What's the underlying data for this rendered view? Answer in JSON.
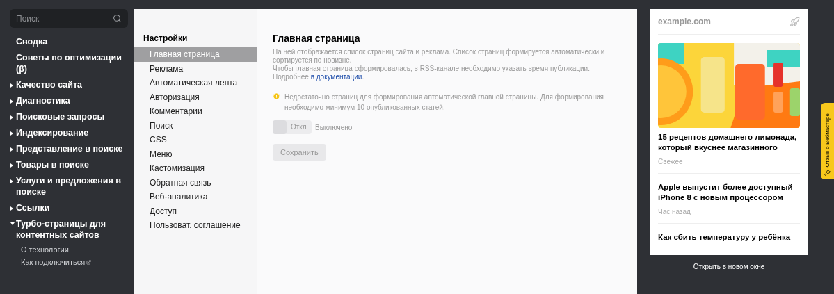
{
  "search": {
    "placeholder": "Поиск"
  },
  "sidebar": {
    "items": [
      {
        "label": "Сводка",
        "kind": "link"
      },
      {
        "label": "Советы по оптимизации (β)",
        "kind": "link"
      },
      {
        "label": "Качество сайта",
        "kind": "group",
        "expanded": false
      },
      {
        "label": "Диагностика",
        "kind": "group",
        "expanded": false
      },
      {
        "label": "Поисковые запросы",
        "kind": "group",
        "expanded": false
      },
      {
        "label": "Индексирование",
        "kind": "group",
        "expanded": false
      },
      {
        "label": "Представление в поиске",
        "kind": "group",
        "expanded": false
      },
      {
        "label": "Товары в поиске",
        "kind": "group",
        "expanded": false
      },
      {
        "label": "Услуги и предложения в поиске",
        "kind": "group",
        "expanded": false
      },
      {
        "label": "Ссылки",
        "kind": "group",
        "expanded": false
      },
      {
        "label": "Турбо-страницы для контентных сайтов",
        "kind": "group",
        "expanded": true,
        "children": [
          {
            "label": "О технологии",
            "external": false
          },
          {
            "label": "Как подключиться",
            "external": true
          }
        ]
      }
    ]
  },
  "settings_nav": {
    "title": "Настройки",
    "items": [
      {
        "label": "Главная страница",
        "selected": true
      },
      {
        "label": "Реклама",
        "selected": false
      },
      {
        "label": "Автоматическая лента",
        "selected": false
      },
      {
        "label": "Авторизация",
        "selected": false
      },
      {
        "label": "Комментарии",
        "selected": false
      },
      {
        "label": "Поиск",
        "selected": false
      },
      {
        "label": "CSS",
        "selected": false
      },
      {
        "label": "Меню",
        "selected": false
      },
      {
        "label": "Кастомизация",
        "selected": false
      },
      {
        "label": "Обратная связь",
        "selected": false
      },
      {
        "label": "Веб-аналитика",
        "selected": false
      },
      {
        "label": "Доступ",
        "selected": false
      },
      {
        "label": "Пользоват. соглашение",
        "selected": false
      }
    ]
  },
  "content": {
    "title": "Главная страница",
    "description": "На ней отображается список страниц сайта и реклама. Список страниц формируется автоматически и сортируется по новизне.",
    "note": "Чтобы главная страница сформировалась, в RSS-канале необходимо указать время публикации. Подробнее",
    "note_link": "в документации",
    "note_end": ".",
    "warning": "Недостаточно страниц для формирования автоматической главной страницы. Для формирования необходимо минимум 10 опубликованных статей.",
    "toggle": {
      "on": false,
      "label": "Откл",
      "status": "Выключено"
    },
    "save_button": {
      "label": "Сохранить",
      "disabled": true
    }
  },
  "preview": {
    "domain": "example.com",
    "articles": [
      {
        "title": "15 рецептов домашнего лимонада, который вкуснее магазинного",
        "time": "Свежее",
        "kind": "picture"
      },
      {
        "title": "Apple выпустит более доступный iPhone 8 с новым процессором",
        "time": "Час назад"
      },
      {
        "title": "Как сбить температуру у ребёнка"
      }
    ],
    "open_link": "Открыть в новом окне"
  },
  "feedback_tab": {
    "label": "Отзыв о Вебмастере"
  }
}
